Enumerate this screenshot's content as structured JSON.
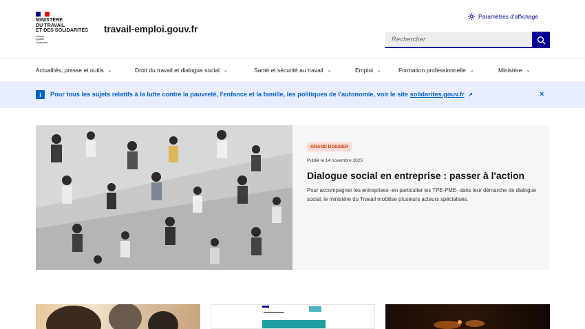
{
  "header": {
    "ministry_lines": [
      "MINISTÈRE",
      "DU TRAVAIL",
      "ET DES SOLIDARITÉS"
    ],
    "motto": [
      "Liberté",
      "Égalité",
      "Fraternité"
    ],
    "site_name": "travail-emploi.gouv.fr",
    "display_settings": "Paramètres d'affichage",
    "search_placeholder": "Rechercher",
    "flag_colors": [
      "#000091",
      "#ffffff",
      "#e1000f"
    ]
  },
  "nav": {
    "items": [
      {
        "label": "Actualités, presse et outils"
      },
      {
        "label": "Droit du travail et dialogue social"
      },
      {
        "label": "Santé et sécurité au travail"
      },
      {
        "label": "Emploi"
      },
      {
        "label": "Formation professionnelle"
      },
      {
        "label": "Ministère"
      }
    ]
  },
  "notice": {
    "text": "Pour tous les sujets relatifs à la lutte contre la pauvreté, l'enfance et la famille, les politiques de l'autonomie, voir le site ",
    "link": "solidarites.gouv.fr",
    "icon": "info-icon",
    "close": "×"
  },
  "feature": {
    "badge": "GRAND DOSSIER",
    "date": "Publié le 14 novembre 2025",
    "title": "Dialogue social en entreprise : passer à l'action",
    "description": "Pour accompagner les entreprises -en particulier les TPE-PME- dans leur démarche de dialogue social, le ministère du Travail mobilise plusieurs acteurs spécialisés."
  },
  "colors": {
    "brand_blue": "#000091",
    "info_blue": "#0063cb",
    "notice_bg": "#e8edff",
    "badge_text": "#b34000"
  }
}
